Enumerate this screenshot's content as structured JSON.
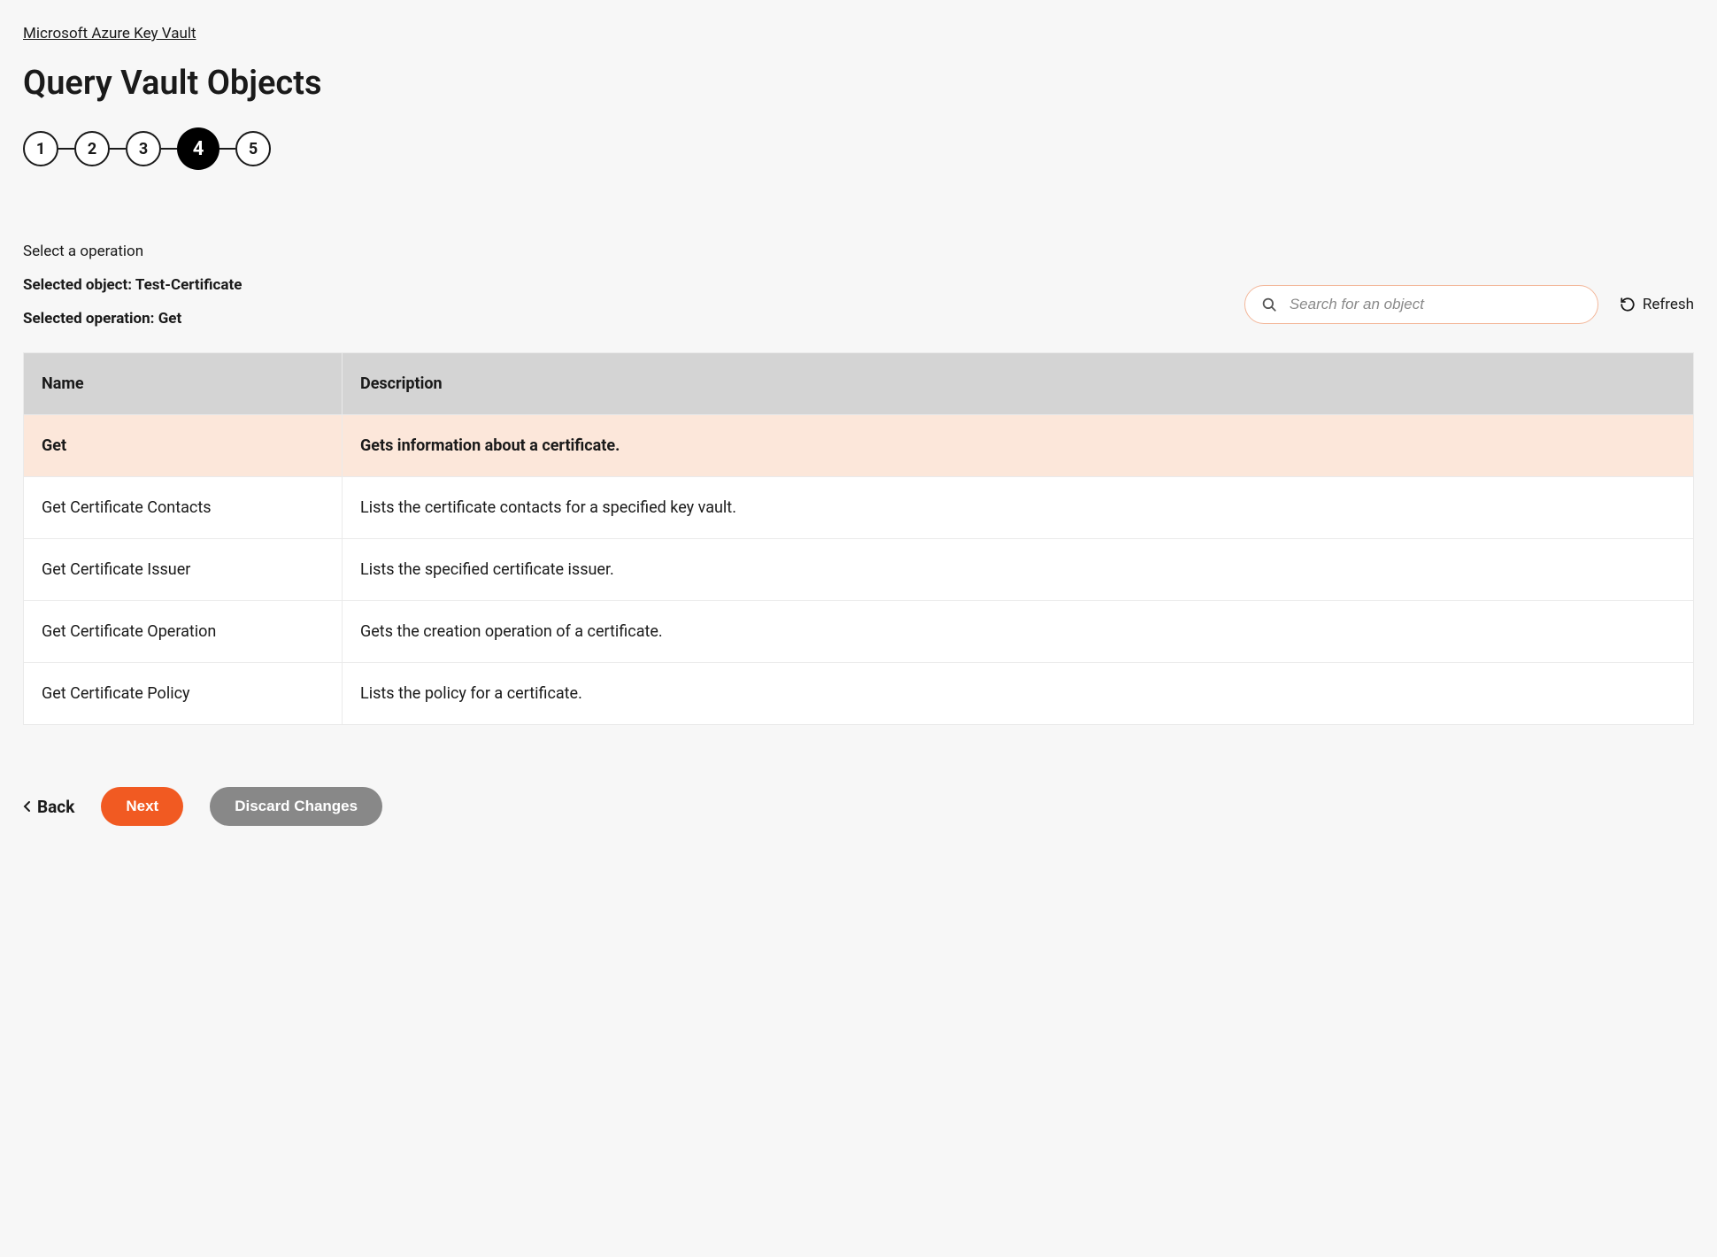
{
  "breadcrumb": "Microsoft Azure Key Vault",
  "page_title": "Query Vault Objects",
  "stepper": {
    "steps": [
      "1",
      "2",
      "3",
      "4",
      "5"
    ],
    "active_index": 3
  },
  "info": {
    "select_label": "Select a operation",
    "selected_object_label": "Selected object: Test-Certificate",
    "selected_operation_label": "Selected operation: Get"
  },
  "search": {
    "placeholder": "Search for an object",
    "value": ""
  },
  "refresh_label": "Refresh",
  "table": {
    "headers": {
      "name": "Name",
      "description": "Description"
    },
    "rows": [
      {
        "name": "Get",
        "description": "Gets information about a certificate.",
        "selected": true
      },
      {
        "name": "Get Certificate Contacts",
        "description": "Lists the certificate contacts for a specified key vault.",
        "selected": false
      },
      {
        "name": "Get Certificate Issuer",
        "description": "Lists the specified certificate issuer.",
        "selected": false
      },
      {
        "name": "Get Certificate Operation",
        "description": "Gets the creation operation of a certificate.",
        "selected": false
      },
      {
        "name": "Get Certificate Policy",
        "description": "Lists the policy for a certificate.",
        "selected": false
      }
    ]
  },
  "actions": {
    "back": "Back",
    "next": "Next",
    "discard": "Discard Changes"
  }
}
